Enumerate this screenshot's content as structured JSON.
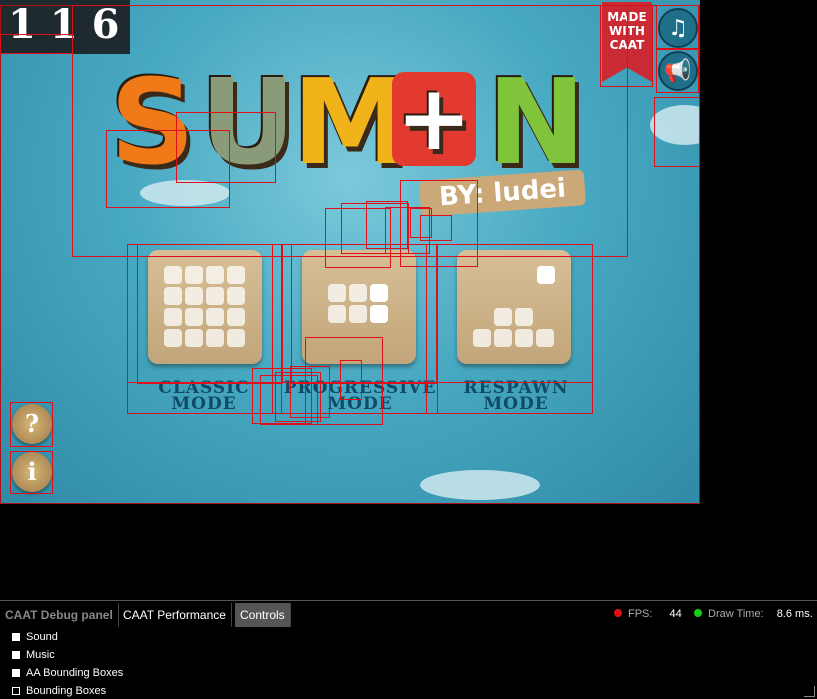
{
  "game": {
    "score": "116",
    "logo": {
      "letters": [
        "S",
        "U",
        "M",
        "+",
        "N"
      ],
      "byline": "BY: ludei"
    },
    "ribbon": {
      "line1": "MADE",
      "line2": "WITH",
      "line3": "CAAT"
    },
    "buttons": {
      "music_icon": "music-note-icon",
      "sound_icon": "megaphone-icon"
    },
    "modes": [
      {
        "line1": "CLASSIC",
        "line2": "MODE"
      },
      {
        "line1": "PROGRESSIVE",
        "line2": "MODE"
      },
      {
        "line1": "RESPAWN",
        "line2": "MODE"
      }
    ],
    "help_label": "?",
    "info_label": "i",
    "colors": {
      "sky": "#48a9c2",
      "card": "#c8ab80",
      "label": "#0f4a67",
      "debug_box": "#e0101a"
    }
  },
  "debug_panel": {
    "tabs": [
      "CAAT Debug panel",
      "CAAT Performance",
      "Controls"
    ],
    "active_tab": "Controls",
    "fps_label": "FPS:",
    "fps_value": "44",
    "draw_label": "Draw Time:",
    "draw_value": "8.6",
    "draw_unit": "ms.",
    "controls": [
      {
        "label": "Sound",
        "checked": true
      },
      {
        "label": "Music",
        "checked": true
      },
      {
        "label": "AA Bounding Boxes",
        "checked": true
      },
      {
        "label": "Bounding Boxes",
        "checked": false
      }
    ]
  }
}
